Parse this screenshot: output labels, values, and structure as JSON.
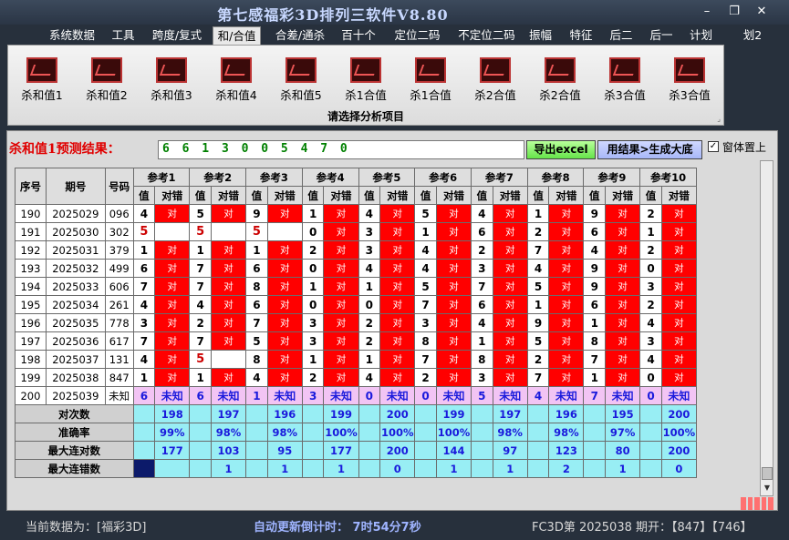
{
  "window": {
    "title": "第七感福彩3D排列三软件V8.80",
    "min": "–",
    "max": "❐",
    "close": "✕"
  },
  "menu": [
    {
      "label": "系统数据"
    },
    {
      "label": "工具"
    },
    {
      "label": "跨度/复式"
    },
    {
      "label": "和/合值",
      "active": true
    },
    {
      "label": "合差/通杀"
    },
    {
      "label": "百十个"
    },
    {
      "label": "定位二码"
    },
    {
      "label": "不定位二码"
    },
    {
      "label": "振幅"
    },
    {
      "label": "特征"
    },
    {
      "label": "后二"
    },
    {
      "label": "后一"
    },
    {
      "label": "计划"
    },
    {
      "label": "划2"
    }
  ],
  "ribbon": {
    "items": [
      "杀和值1",
      "杀和值2",
      "杀和值3",
      "杀和值4",
      "杀和值5",
      "杀1合值",
      "杀1合值",
      "杀2合值",
      "杀2合值",
      "杀3合值",
      "杀3合值"
    ],
    "caption": "请选择分析项目",
    "corner": "⌟"
  },
  "prediction": {
    "label": "杀和值1预测结果：",
    "value": "6 6 1 3 0 0 5 4 7 0",
    "export_label": "导出excel",
    "generate_label": "用结果>生成大底",
    "top_checkbox_label": "窗体置上",
    "top_checkbox_checked": true
  },
  "grid": {
    "header": {
      "seq": "序号",
      "issue": "期号",
      "code": "号码",
      "refs": [
        "参考1",
        "参考2",
        "参考3",
        "参考4",
        "参考5",
        "参考6",
        "参考7",
        "参考8",
        "参考9",
        "参考10"
      ],
      "val": "值",
      "hit": "对错"
    },
    "hit_text": "对",
    "rows": [
      {
        "seq": "190",
        "issue": "2025029",
        "code": "096",
        "v": [
          "4",
          "5",
          "9",
          "1",
          "4",
          "5",
          "4",
          "1",
          "9",
          "2"
        ],
        "h": [
          1,
          1,
          1,
          1,
          1,
          1,
          1,
          1,
          1,
          1
        ]
      },
      {
        "seq": "191",
        "issue": "2025030",
        "code": "302",
        "v": [
          "5",
          "5",
          "5",
          "0",
          "3",
          "1",
          "6",
          "2",
          "6",
          "1"
        ],
        "h": [
          0,
          0,
          0,
          1,
          1,
          1,
          1,
          1,
          1,
          1
        ]
      },
      {
        "seq": "192",
        "issue": "2025031",
        "code": "379",
        "v": [
          "1",
          "1",
          "1",
          "2",
          "3",
          "4",
          "2",
          "7",
          "4",
          "2"
        ],
        "h": [
          1,
          1,
          1,
          1,
          1,
          1,
          1,
          1,
          1,
          1
        ]
      },
      {
        "seq": "193",
        "issue": "2025032",
        "code": "499",
        "v": [
          "6",
          "7",
          "6",
          "0",
          "4",
          "4",
          "3",
          "4",
          "9",
          "0"
        ],
        "h": [
          1,
          1,
          1,
          1,
          1,
          1,
          1,
          1,
          1,
          1
        ]
      },
      {
        "seq": "194",
        "issue": "2025033",
        "code": "606",
        "v": [
          "7",
          "7",
          "8",
          "1",
          "1",
          "5",
          "7",
          "5",
          "9",
          "3"
        ],
        "h": [
          1,
          1,
          1,
          1,
          1,
          1,
          1,
          1,
          1,
          1
        ]
      },
      {
        "seq": "195",
        "issue": "2025034",
        "code": "261",
        "v": [
          "4",
          "4",
          "6",
          "0",
          "0",
          "7",
          "6",
          "1",
          "6",
          "2"
        ],
        "h": [
          1,
          1,
          1,
          1,
          1,
          1,
          1,
          1,
          1,
          1
        ]
      },
      {
        "seq": "196",
        "issue": "2025035",
        "code": "778",
        "v": [
          "3",
          "2",
          "7",
          "3",
          "2",
          "3",
          "4",
          "9",
          "1",
          "4"
        ],
        "h": [
          1,
          1,
          1,
          1,
          1,
          1,
          1,
          1,
          1,
          1
        ]
      },
      {
        "seq": "197",
        "issue": "2025036",
        "code": "617",
        "v": [
          "7",
          "7",
          "5",
          "3",
          "2",
          "8",
          "1",
          "5",
          "8",
          "3"
        ],
        "h": [
          1,
          1,
          1,
          1,
          1,
          1,
          1,
          1,
          1,
          1
        ]
      },
      {
        "seq": "198",
        "issue": "2025037",
        "code": "131",
        "v": [
          "4",
          "5",
          "8",
          "1",
          "1",
          "7",
          "8",
          "2",
          "7",
          "4"
        ],
        "h": [
          1,
          0,
          1,
          1,
          1,
          1,
          1,
          1,
          1,
          1
        ]
      },
      {
        "seq": "199",
        "issue": "2025038",
        "code": "847",
        "v": [
          "1",
          "1",
          "4",
          "2",
          "4",
          "2",
          "3",
          "7",
          "1",
          "0"
        ],
        "h": [
          1,
          1,
          1,
          1,
          1,
          1,
          1,
          1,
          1,
          1
        ]
      }
    ],
    "predict_row": {
      "seq": "200",
      "issue": "2025039",
      "code": "未知",
      "v": [
        "6",
        "6",
        "1",
        "3",
        "0",
        "0",
        "5",
        "4",
        "7",
        "0"
      ],
      "h": "未知"
    },
    "stats": [
      {
        "label": "对次数",
        "values": [
          "198",
          "197",
          "196",
          "199",
          "200",
          "199",
          "197",
          "196",
          "195",
          "200"
        ]
      },
      {
        "label": "准确率",
        "values": [
          "99%",
          "98%",
          "98%",
          "100%",
          "100%",
          "100%",
          "98%",
          "98%",
          "97%",
          "100%"
        ]
      },
      {
        "label": "最大连对数",
        "values": [
          "177",
          "103",
          "95",
          "177",
          "200",
          "144",
          "97",
          "123",
          "80",
          "200"
        ]
      },
      {
        "label": "最大连错数",
        "values": [
          "",
          "1",
          "1",
          "1",
          "0",
          "1",
          "1",
          "2",
          "1",
          "0"
        ]
      }
    ]
  },
  "status": {
    "current_data": "当前数据为：[福彩3D]",
    "countdown": "自动更新倒计时：  7时54分7秒",
    "last": "FC3D第 2025038 期开：【847】【746】"
  },
  "colors": {
    "hit": "#ff0000",
    "predict_row": "#f2c4f4",
    "stat_row": "#98eef4",
    "blue_text": "#1a1adc"
  }
}
